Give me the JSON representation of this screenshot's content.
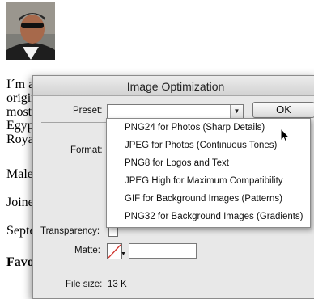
{
  "background_page": {
    "line1": "I´m a",
    "line2": "origin",
    "line3": "mostl",
    "line4": "Egyp",
    "line5": "Roya",
    "line6": "Male",
    "line7": "Joine",
    "line8": "Septe",
    "line9": "Favo"
  },
  "dialog": {
    "title": "Image Optimization",
    "preset_label": "Preset:",
    "preset_value": "",
    "ok_label": "OK",
    "format_label": "Format:",
    "transparency_label": "Transparency:",
    "matte_label": "Matte:",
    "matte_value": "",
    "filesize_label": "File size:",
    "filesize_value": "13 K"
  },
  "preset_options": [
    {
      "label": "PNG24 for Photos (Sharp Details)",
      "selected": true
    },
    {
      "label": "JPEG for Photos (Continuous Tones)",
      "selected": false
    },
    {
      "label": "PNG8 for Logos and Text",
      "selected": false
    },
    {
      "label": "JPEG High for Maximum Compatibility",
      "selected": false
    },
    {
      "label": "GIF for Background Images (Patterns)",
      "selected": false
    },
    {
      "label": "PNG32 for Background Images (Gradients)",
      "selected": false
    }
  ],
  "icons": {
    "dropdown": "chevron-down-icon",
    "matte_swatch": "no-color-swatch-icon",
    "cursor": "mouse-pointer-icon"
  },
  "colors": {
    "dialog_bg": "#e8e8e8",
    "swatch_slash": "#d0342c"
  }
}
